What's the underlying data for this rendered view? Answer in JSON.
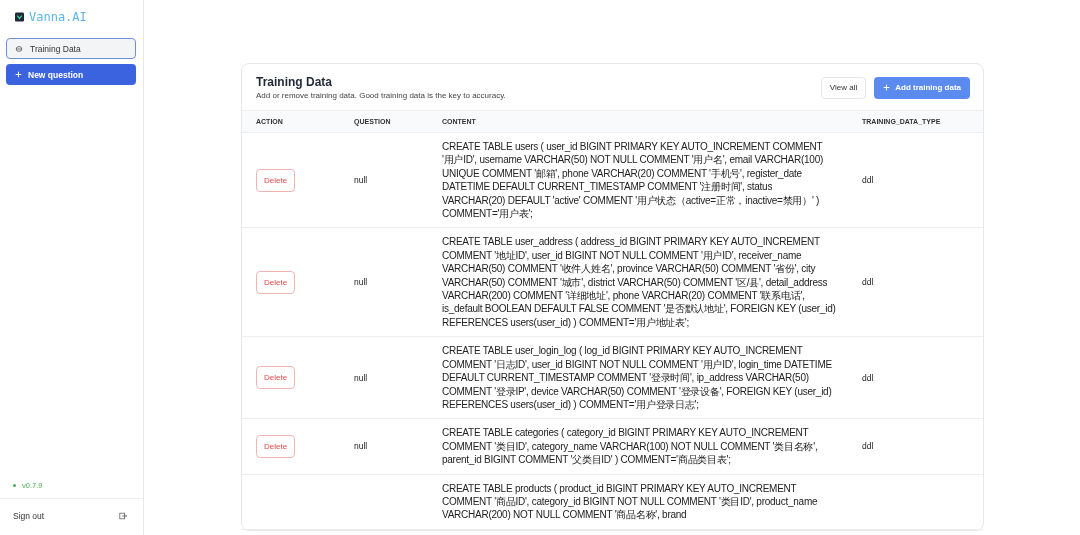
{
  "sidebar": {
    "logo": "Vanna.AI",
    "items": [
      {
        "label": "Training Data",
        "selected": true
      }
    ],
    "new_question": "New question",
    "version": "v0.7.9",
    "sign_out": "Sign out"
  },
  "card": {
    "title": "Training Data",
    "subtitle": "Add or remove training data. Good training data is the key to accuracy.",
    "buttons": [
      {
        "label": "View all",
        "kind": "plain"
      },
      {
        "label": "Add training data",
        "kind": "primary"
      }
    ]
  },
  "table": {
    "columns": [
      "ACTION",
      "QUESTION",
      "CONTENT",
      "TRAINING_DATA_TYPE"
    ],
    "rows": [
      {
        "action": "Delete",
        "question": "null",
        "content": "CREATE TABLE users ( user_id BIGINT PRIMARY KEY AUTO_INCREMENT COMMENT '用户ID', username VARCHAR(50) NOT NULL COMMENT '用户名', email VARCHAR(100) UNIQUE COMMENT '邮箱', phone VARCHAR(20) COMMENT '手机号', register_date DATETIME DEFAULT CURRENT_TIMESTAMP COMMENT '注册时间', status VARCHAR(20) DEFAULT 'active' COMMENT '用户状态（active=正常，inactive=禁用）' ) COMMENT='用户表';",
        "type": "ddl"
      },
      {
        "action": "Delete",
        "question": "null",
        "content": "CREATE TABLE user_address ( address_id BIGINT PRIMARY KEY AUTO_INCREMENT COMMENT '地址ID', user_id BIGINT NOT NULL COMMENT '用户ID', receiver_name VARCHAR(50) COMMENT '收件人姓名', province VARCHAR(50) COMMENT '省份', city VARCHAR(50) COMMENT '城市', district VARCHAR(50) COMMENT '区/县', detail_address VARCHAR(200) COMMENT '详细地址', phone VARCHAR(20) COMMENT '联系电话', is_default BOOLEAN DEFAULT FALSE COMMENT '是否默认地址', FOREIGN KEY (user_id) REFERENCES users(user_id) ) COMMENT='用户地址表';",
        "type": "ddl"
      },
      {
        "action": "Delete",
        "question": "null",
        "content": "CREATE TABLE user_login_log ( log_id BIGINT PRIMARY KEY AUTO_INCREMENT COMMENT '日志ID', user_id BIGINT NOT NULL COMMENT '用户ID', login_time DATETIME DEFAULT CURRENT_TIMESTAMP COMMENT '登录时间', ip_address VARCHAR(50) COMMENT '登录IP', device VARCHAR(50) COMMENT '登录设备', FOREIGN KEY (user_id) REFERENCES users(user_id) ) COMMENT='用户登录日志';",
        "type": "ddl"
      },
      {
        "action": "Delete",
        "question": "null",
        "content": "CREATE TABLE categories ( category_id BIGINT PRIMARY KEY AUTO_INCREMENT COMMENT '类目ID', category_name VARCHAR(100) NOT NULL COMMENT '类目名称', parent_id BIGINT COMMENT '父类目ID' ) COMMENT='商品类目表';",
        "type": "ddl"
      },
      {
        "content": "CREATE TABLE products ( product_id BIGINT PRIMARY KEY AUTO_INCREMENT COMMENT '商品ID', category_id BIGINT NOT NULL COMMENT '类目ID', product_name VARCHAR(200) NOT NULL COMMENT '商品名称', brand"
      }
    ]
  }
}
